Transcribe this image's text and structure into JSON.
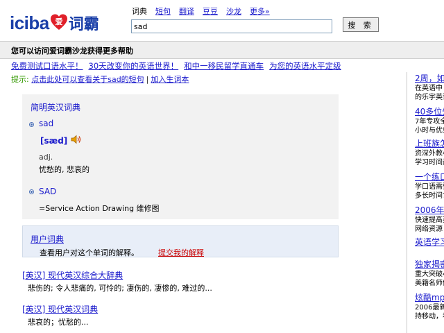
{
  "logo": {
    "text": "iciba",
    "heart_text": "爱",
    "cn_text": "词霸"
  },
  "nav": {
    "items": [
      "词典",
      "短句",
      "翻译",
      "豆豆",
      "沙龙",
      "更多»"
    ],
    "current": 0
  },
  "search": {
    "value": "sad",
    "button_label": "搜 索"
  },
  "help_bar": {
    "text": "您可以访问爱词霸沙龙获得更多帮助"
  },
  "promo_links": [
    "免费测试口语水平！",
    "30天改变你的英语世界！",
    "和中一移民留学直通车",
    "为您的英语水平定级"
  ],
  "tip": {
    "label": "提示:",
    "link1": "点击此处可以查看关于sad的短句",
    "separator": "|",
    "link2": "加入生词本"
  },
  "concise": {
    "title": "简明英汉词典",
    "entry1": {
      "word": "sad",
      "phonetic": "[sæd]",
      "pos": "adj.",
      "definition": "忧愁的, 悲哀的"
    },
    "entry2": {
      "word": "SAD",
      "definition": "=Service Action Drawing 维修图"
    }
  },
  "user_dict": {
    "title": "用户词典",
    "description": "查看用户对这个单词的解释。",
    "submit_label": "提交我的解释"
  },
  "other_dicts": [
    {
      "title": "[英汉] 现代英汉综合大辞典",
      "excerpt": "悲伤的; 令人悲痛的, 可怜的; 凄伤的, 凄惨的, 难过的..."
    },
    {
      "title": "[英汉] 现代英汉词典",
      "excerpt": "悲哀的；忧愁的..."
    }
  ],
  "sidebar": [
    {
      "head": "2周，如",
      "lines": [
        "在英语中",
        "的乐宇英语"
      ]
    },
    {
      "head": "40多位外",
      "lines": [
        "7年专攻全",
        "小时与优师"
      ]
    },
    {
      "head": "上班族怎",
      "lines": [
        "资深外教小",
        "学习时间最"
      ]
    },
    {
      "head": "一个练口",
      "lines": [
        "学口语需要",
        "多长时间?"
      ]
    },
    {
      "head": "2006年",
      "lines": [
        "快速提高英",
        "网络资源"
      ]
    },
    {
      "head": "英语学习",
      "lines": []
    },
    {
      "head": "独家揭密",
      "lines": [
        "重大突破4",
        "美籍名师倾"
      ]
    },
    {
      "head": "炫酷mp3",
      "lines": [
        "2006最新",
        "持移动，看"
      ]
    }
  ],
  "colors": {
    "link": "#1a1acc",
    "logo_blue": "#1a3fa8",
    "logo_heart": "#e0202a",
    "tip_green": "#339900",
    "submit_red": "#cc0000"
  }
}
